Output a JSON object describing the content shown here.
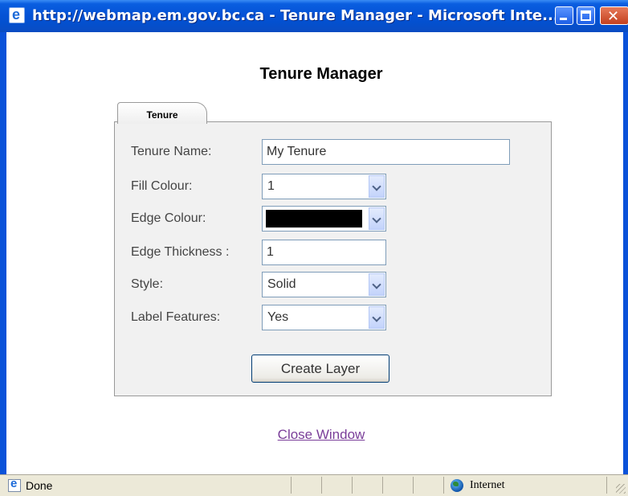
{
  "window": {
    "title": "http://webmap.em.gov.bc.ca - Tenure Manager - Microsoft Inte...",
    "minimize_icon": "minimize-icon",
    "maximize_icon": "maximize-icon",
    "close_icon": "close-icon"
  },
  "page": {
    "heading": "Tenure Manager",
    "tab_label": "Tenure"
  },
  "form": {
    "tenure_name": {
      "label": "Tenure Name:",
      "value": "My Tenure"
    },
    "fill_colour": {
      "label": "Fill Colour:",
      "value": "1"
    },
    "edge_colour": {
      "label": "Edge Colour:",
      "value_color": "#000000"
    },
    "edge_thickness": {
      "label": "Edge Thickness :",
      "value": "1"
    },
    "style": {
      "label": "Style:",
      "value": "Solid"
    },
    "label_features": {
      "label": "Label Features:",
      "value": "Yes"
    },
    "create_button": "Create Layer"
  },
  "links": {
    "close_window": "Close Window"
  },
  "statusbar": {
    "status": "Done",
    "zone": "Internet"
  },
  "colors": {
    "titlebar": "#0553d6",
    "panel_bg": "#f1f1f1",
    "link_visited": "#7a3e99"
  }
}
